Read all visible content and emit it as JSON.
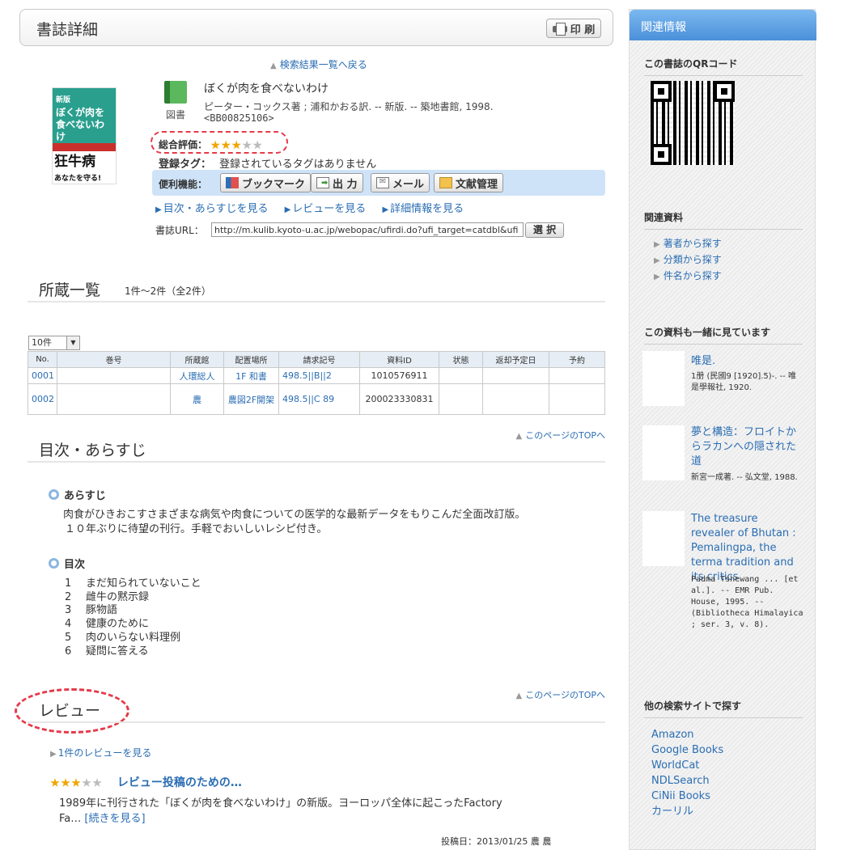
{
  "header": {
    "title": "書誌詳細",
    "print_label": "印 刷"
  },
  "back_link": "検索結果一覧へ戻る",
  "cover": {
    "line1": "ぼくが肉を食べないわけ",
    "line2": "狂牛病",
    "line3": "あなたを守る!",
    "badge": "新版"
  },
  "material": {
    "label": "図書"
  },
  "book": {
    "title": "ぼくが肉を食べないわけ",
    "responsibility": "ピーター・コックス著 ; 浦和かおる訳. -- 新版. -- 築地書館, 1998.",
    "bibid": "<BB00825106>"
  },
  "rating": {
    "label": "総合評価：",
    "stars": 3,
    "max": 5
  },
  "tags": {
    "label": "登録タグ：",
    "value": "登録されているタグはありません"
  },
  "tools": {
    "label": "便利機能：",
    "bookmark": "ブックマーク",
    "output": "出 力",
    "mail": "メール",
    "refmgr": "文献管理"
  },
  "sub_links": [
    "目次・あらすじを見る",
    "レビューを見る",
    "詳細情報を見る"
  ],
  "url": {
    "label": "書誌URL：",
    "value": "http://m.kulib.kyoto-u.ac.jp/webopac/ufirdi.do?ufi_target=catdbl&ufi",
    "select_label": "選 択"
  },
  "holdings": {
    "title": "所蔵一覧",
    "count": "1件～2件（全2件）",
    "per_page": "10件",
    "columns": [
      "No.",
      "巻号",
      "所蔵館",
      "配置場所",
      "請求記号",
      "資料ID",
      "状態",
      "返却予定日",
      "予約"
    ],
    "rows": [
      {
        "no": "0001",
        "vol": "",
        "lib": "人環総人",
        "loc": "1F 和書",
        "call": "498.5||B||2",
        "id": "1010576911",
        "status": "",
        "due": "",
        "reserve": ""
      },
      {
        "no": "0002",
        "vol": "",
        "lib": "農",
        "loc": "農図2F開架",
        "call": "498.5||C 89",
        "id": "200023330831",
        "status": "",
        "due": "",
        "reserve": ""
      }
    ]
  },
  "page_top": "このページのTOPへ",
  "contents": {
    "title": "目次・あらすじ",
    "synopsis_head": "あらすじ",
    "synopsis_line1": "肉食がひきおこすさまざまな病気や肉食についての医学的な最新データをもりこんだ全面改訂版。",
    "synopsis_line2": "１０年ぶりに待望の刊行。手軽でおいしいレシピ付き。",
    "toc_head": "目次",
    "toc": [
      {
        "n": "1",
        "t": "まだ知られていないこと"
      },
      {
        "n": "2",
        "t": "雌牛の黙示録"
      },
      {
        "n": "3",
        "t": "豚物語"
      },
      {
        "n": "4",
        "t": "健康のために"
      },
      {
        "n": "5",
        "t": "肉のいらない料理例"
      },
      {
        "n": "6",
        "t": "疑問に答える"
      }
    ]
  },
  "review": {
    "title": "レビュー",
    "count_link": "1件のレビューを見る",
    "stars": 3,
    "review_title": "レビュー投稿のための…",
    "body_line1": "1989年に刊行された「ぼくが肉を食べないわけ」の新版。ヨーロッパ全体に起こったFactory",
    "body_line2": "Fa… ",
    "more": "[続きを見る]",
    "date": "投稿日：2013/01/25 農 農"
  },
  "sidebar": {
    "title": "関連情報",
    "qr_title": "この書誌のQRコード",
    "related_title": "関連資料",
    "related_links": [
      "著者から探す",
      "分類から探す",
      "件名から探す"
    ],
    "also_title": "この資料も一緒に見ています",
    "also": [
      {
        "title": "唯是.",
        "meta": "1册 (民國9 [1920].5)-. -- 唯是學報社, 1920."
      },
      {
        "title": "夢と構造：フロイトからラカンへの隠された道",
        "meta": "新宮一成著. -- 弘文堂, 1988."
      },
      {
        "title": "The treasure revealer of Bhutan : Pemalingpa, the terma tradition and its critics",
        "meta": "Padma Tshewang ... [et al.]. -- EMR Pub. House, 1995. -- (Bibliotheca Himalayica ; ser. 3, v. 8)."
      }
    ],
    "other_title": "他の検索サイトで探す",
    "other_links": [
      "Amazon",
      "Google Books",
      "WorldCat",
      "NDLSearch",
      "CiNii Books",
      "カーリル"
    ]
  }
}
